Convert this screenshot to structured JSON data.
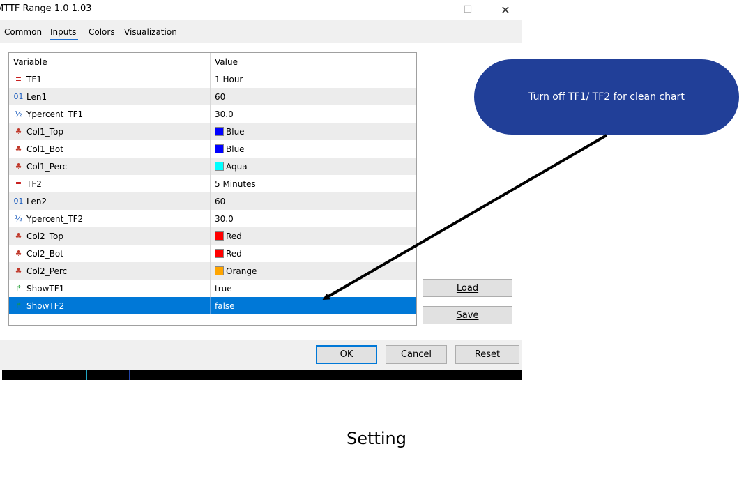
{
  "window": {
    "title": "MTTF Range 1.0 1.03",
    "minimize_glyph": "—",
    "maximize_glyph": "☐",
    "close_glyph": "✕"
  },
  "tabs": [
    "Common",
    "Inputs",
    "Colors",
    "Visualization"
  ],
  "active_tab": "Inputs",
  "grid": {
    "headers": {
      "variable": "Variable",
      "value": "Value"
    },
    "rows": [
      {
        "icon": "list-icon",
        "glyph": "≡",
        "glyph_color": "#c00000",
        "variable": "TF1",
        "value": "1 Hour"
      },
      {
        "icon": "integer-icon",
        "glyph": "01",
        "glyph_color": "#1f5fbf",
        "variable": "Len1",
        "value": "60"
      },
      {
        "icon": "fraction-icon",
        "glyph": "½",
        "glyph_color": "#1f5fbf",
        "variable": "Ypercent_TF1",
        "value": "30.0"
      },
      {
        "icon": "color-palette-icon",
        "glyph": "♣",
        "glyph_color": "#c0392b",
        "variable": "Col1_Top",
        "value": "Blue",
        "swatch": "#0000ff"
      },
      {
        "icon": "color-palette-icon",
        "glyph": "♣",
        "glyph_color": "#c0392b",
        "variable": "Col1_Bot",
        "value": "Blue",
        "swatch": "#0000ff"
      },
      {
        "icon": "color-palette-icon",
        "glyph": "♣",
        "glyph_color": "#c0392b",
        "variable": "Col1_Perc",
        "value": "Aqua",
        "swatch": "#00ffff"
      },
      {
        "icon": "list-icon",
        "glyph": "≡",
        "glyph_color": "#c00000",
        "variable": "TF2",
        "value": "5 Minutes"
      },
      {
        "icon": "integer-icon",
        "glyph": "01",
        "glyph_color": "#1f5fbf",
        "variable": "Len2",
        "value": "60"
      },
      {
        "icon": "fraction-icon",
        "glyph": "½",
        "glyph_color": "#1f5fbf",
        "variable": "Ypercent_TF2",
        "value": "30.0"
      },
      {
        "icon": "color-palette-icon",
        "glyph": "♣",
        "glyph_color": "#c0392b",
        "variable": "Col2_Top",
        "value": "Red",
        "swatch": "#ff0000"
      },
      {
        "icon": "color-palette-icon",
        "glyph": "♣",
        "glyph_color": "#c0392b",
        "variable": "Col2_Bot",
        "value": "Red",
        "swatch": "#ff0000"
      },
      {
        "icon": "color-palette-icon",
        "glyph": "♣",
        "glyph_color": "#c0392b",
        "variable": "Col2_Perc",
        "value": "Orange",
        "swatch": "#ffa500"
      },
      {
        "icon": "boolean-arrow-icon",
        "glyph": "↱",
        "glyph_color": "#1a9c2e",
        "variable": "ShowTF1",
        "value": "true"
      },
      {
        "icon": "boolean-arrow-icon",
        "glyph": "↱",
        "glyph_color": "#1a9c2e",
        "variable": "ShowTF2",
        "value": "false",
        "selected": true
      }
    ]
  },
  "side_buttons": {
    "load": "Load",
    "save": "Save"
  },
  "footer_buttons": {
    "ok": "OK",
    "cancel": "Cancel",
    "reset": "Reset"
  },
  "callout": {
    "text": "Turn off TF1/ TF2 for clean chart",
    "color": "#213f98"
  },
  "caption": "Setting",
  "colors": {
    "selection": "#0078d7",
    "accent": "#1f6fd1"
  }
}
